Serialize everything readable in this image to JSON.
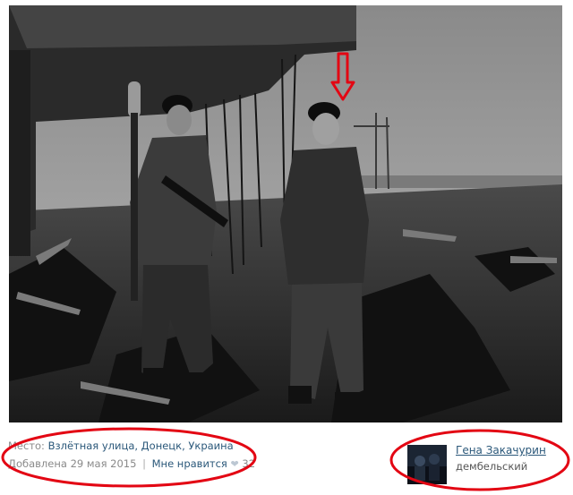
{
  "post": {
    "place_label": "Место:",
    "place_value": "Взлётная улица, Донецк, Украина",
    "added_label": "Добавлена 29 мая 2015",
    "like_label": "Мне нравится",
    "like_count": "32",
    "separator": "|"
  },
  "author": {
    "name": "Гена Закачурин",
    "status": "дембельский"
  },
  "annotations": {
    "marker_color": "#e30613"
  },
  "icons": [
    "heart-icon",
    "arrow-down-icon"
  ]
}
